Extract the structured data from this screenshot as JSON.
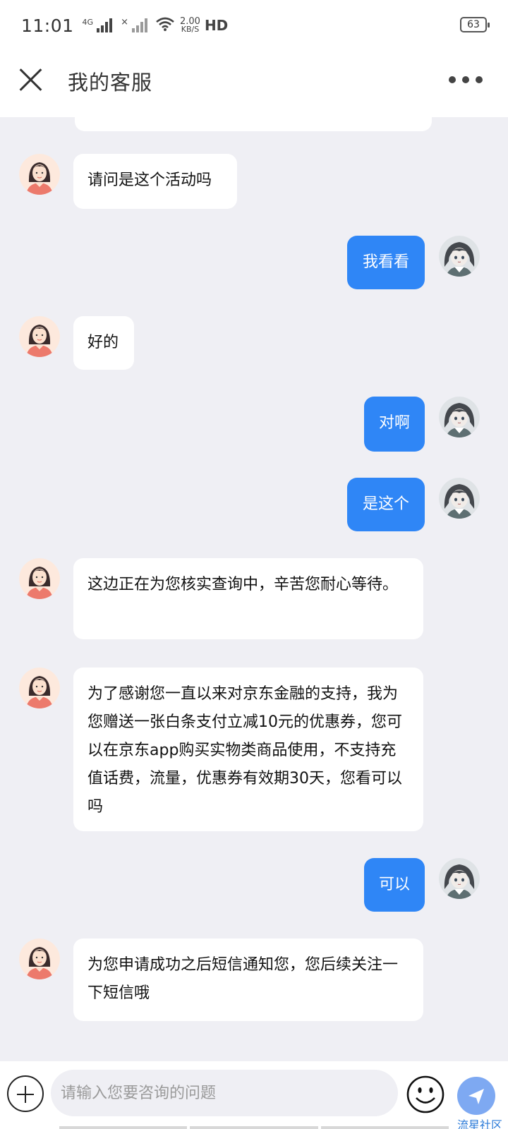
{
  "status_bar": {
    "time": "11:01",
    "signal_1": "4G",
    "signal_2": "×",
    "net_speed_value": "2.00",
    "net_speed_unit": "KB/S",
    "hd": "HD",
    "battery": "63"
  },
  "header": {
    "title": "我的客服",
    "close_icon": "close-icon",
    "more_icon": "more-icon"
  },
  "messages": [
    {
      "side": "agent",
      "text": "请问是这个活动吗"
    },
    {
      "side": "user",
      "text": "我看看"
    },
    {
      "side": "agent",
      "text": "好的"
    },
    {
      "side": "user",
      "text": "对啊"
    },
    {
      "side": "user",
      "text": "是这个"
    },
    {
      "side": "agent",
      "text": "这边正在为您核实查询中，辛苦您耐心等待。"
    },
    {
      "side": "agent",
      "text": "为了感谢您一直以来对京东金融的支持，我为您赠送一张白条支付立减10元的优惠券，您可以在京东app购买实物类商品使用，不支持充值话费，流量，优惠券有效期30天，您看可以吗"
    },
    {
      "side": "user",
      "text": "可以"
    },
    {
      "side": "agent",
      "text": "为您申请成功之后短信通知您，您后续关注一下短信哦"
    }
  ],
  "input": {
    "placeholder": "请输入您要咨询的问题",
    "value": ""
  },
  "colors": {
    "user_bubble": "#2f86f6",
    "agent_bubble": "#ffffff",
    "background": "#efeff4",
    "send_button": "#7ea9f2"
  },
  "watermark": "流星社区"
}
